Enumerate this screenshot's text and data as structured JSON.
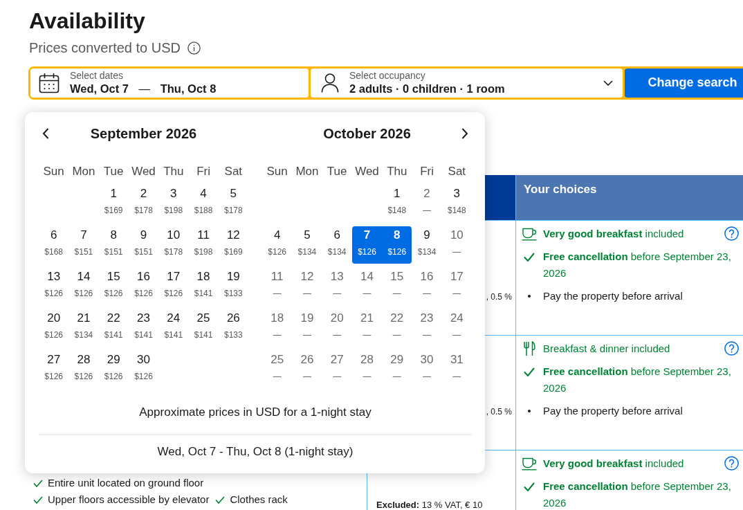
{
  "header": {
    "title": "Availability",
    "subtitle": "Prices converted to USD"
  },
  "search": {
    "dates": {
      "label": "Select dates",
      "check_in": "Wed, Oct 7",
      "separator": "—",
      "check_out": "Thu, Oct 8"
    },
    "occupancy": {
      "label": "Select occupancy",
      "value": "2 adults · 0 children · 1 room"
    },
    "button": "Change search"
  },
  "table": {
    "choices_header": "Your choices",
    "rows": [
      {
        "price": {
          "kind": "fragment",
          "text": ", 0.5 %"
        },
        "choices": [
          {
            "kind": "breakfast",
            "text": "**Very good breakfast** included"
          },
          {
            "kind": "cancellation",
            "text": "**Free cancellation** before September 23, 2026"
          },
          {
            "kind": "payment",
            "text": "Pay the property before arrival"
          }
        ]
      },
      {
        "price": {
          "kind": "fragment",
          "text": ", 0.5 %"
        },
        "choices": [
          {
            "kind": "meals",
            "text": "Breakfast & dinner included"
          },
          {
            "kind": "cancellation",
            "text": "**Free cancellation** before September 23, 2026"
          },
          {
            "kind": "payment",
            "text": "Pay the property before arrival"
          }
        ]
      },
      {
        "facilities": [
          "Entire unit located on ground floor",
          "Upper floors accessible by elevator",
          "Clothes rack"
        ],
        "price": {
          "kind": "excluded",
          "text": "**Excluded:** 13 % VAT, € 10"
        },
        "choices": [
          {
            "kind": "breakfast",
            "text": "**Very good breakfast** included"
          },
          {
            "kind": "cancellation",
            "text": "**Free cancellation** before September 23, 2026"
          }
        ]
      }
    ]
  },
  "calendar": {
    "months": [
      {
        "title": "September 2026",
        "weekdays": [
          "Sun",
          "Mon",
          "Tue",
          "Wed",
          "Thu",
          "Fri",
          "Sat"
        ],
        "days": [
          {
            "kind": "empty"
          },
          {
            "kind": "empty"
          },
          {
            "kind": "day",
            "day": "1",
            "price": "$169",
            "disabled": false,
            "selected": false
          },
          {
            "kind": "day",
            "day": "2",
            "price": "$178",
            "disabled": false,
            "selected": false
          },
          {
            "kind": "day",
            "day": "3",
            "price": "$198",
            "disabled": false,
            "selected": false
          },
          {
            "kind": "day",
            "day": "4",
            "price": "$188",
            "disabled": false,
            "selected": false
          },
          {
            "kind": "day",
            "day": "5",
            "price": "$178",
            "disabled": false,
            "selected": false
          },
          {
            "kind": "day",
            "day": "6",
            "price": "$168",
            "disabled": false,
            "selected": false
          },
          {
            "kind": "day",
            "day": "7",
            "price": "$151",
            "disabled": false,
            "selected": false
          },
          {
            "kind": "day",
            "day": "8",
            "price": "$151",
            "disabled": false,
            "selected": false
          },
          {
            "kind": "day",
            "day": "9",
            "price": "$151",
            "disabled": false,
            "selected": false
          },
          {
            "kind": "day",
            "day": "10",
            "price": "$178",
            "disabled": false,
            "selected": false
          },
          {
            "kind": "day",
            "day": "11",
            "price": "$198",
            "disabled": false,
            "selected": false
          },
          {
            "kind": "day",
            "day": "12",
            "price": "$169",
            "disabled": false,
            "selected": false
          },
          {
            "kind": "day",
            "day": "13",
            "price": "$126",
            "disabled": false,
            "selected": false
          },
          {
            "kind": "day",
            "day": "14",
            "price": "$126",
            "disabled": false,
            "selected": false
          },
          {
            "kind": "day",
            "day": "15",
            "price": "$126",
            "disabled": false,
            "selected": false
          },
          {
            "kind": "day",
            "day": "16",
            "price": "$126",
            "disabled": false,
            "selected": false
          },
          {
            "kind": "day",
            "day": "17",
            "price": "$126",
            "disabled": false,
            "selected": false
          },
          {
            "kind": "day",
            "day": "18",
            "price": "$141",
            "disabled": false,
            "selected": false
          },
          {
            "kind": "day",
            "day": "19",
            "price": "$133",
            "disabled": false,
            "selected": false
          },
          {
            "kind": "day",
            "day": "20",
            "price": "$126",
            "disabled": false,
            "selected": false
          },
          {
            "kind": "day",
            "day": "21",
            "price": "$134",
            "disabled": false,
            "selected": false
          },
          {
            "kind": "day",
            "day": "22",
            "price": "$141",
            "disabled": false,
            "selected": false
          },
          {
            "kind": "day",
            "day": "23",
            "price": "$141",
            "disabled": false,
            "selected": false
          },
          {
            "kind": "day",
            "day": "24",
            "price": "$141",
            "disabled": false,
            "selected": false
          },
          {
            "kind": "day",
            "day": "25",
            "price": "$141",
            "disabled": false,
            "selected": false
          },
          {
            "kind": "day",
            "day": "26",
            "price": "$133",
            "disabled": false,
            "selected": false
          },
          {
            "kind": "day",
            "day": "27",
            "price": "$126",
            "disabled": false,
            "selected": false
          },
          {
            "kind": "day",
            "day": "28",
            "price": "$126",
            "disabled": false,
            "selected": false
          },
          {
            "kind": "day",
            "day": "29",
            "price": "$126",
            "disabled": false,
            "selected": false
          },
          {
            "kind": "day",
            "day": "30",
            "price": "$126",
            "disabled": false,
            "selected": false
          }
        ]
      },
      {
        "title": "October 2026",
        "weekdays": [
          "Sun",
          "Mon",
          "Tue",
          "Wed",
          "Thu",
          "Fri",
          "Sat"
        ],
        "days": [
          {
            "kind": "empty"
          },
          {
            "kind": "empty"
          },
          {
            "kind": "empty"
          },
          {
            "kind": "empty"
          },
          {
            "kind": "day",
            "day": "1",
            "price": "$148",
            "disabled": false,
            "selected": false
          },
          {
            "kind": "day",
            "day": "2",
            "price": "—",
            "disabled": true,
            "selected": false
          },
          {
            "kind": "day",
            "day": "3",
            "price": "$148",
            "disabled": false,
            "selected": false
          },
          {
            "kind": "day",
            "day": "4",
            "price": "$126",
            "disabled": false,
            "selected": false
          },
          {
            "kind": "day",
            "day": "5",
            "price": "$134",
            "disabled": false,
            "selected": false
          },
          {
            "kind": "day",
            "day": "6",
            "price": "$134",
            "disabled": false,
            "selected": false
          },
          {
            "kind": "day",
            "day": "7",
            "price": "$126",
            "disabled": false,
            "selected": true
          },
          {
            "kind": "day",
            "day": "8",
            "price": "$126",
            "disabled": false,
            "selected": true
          },
          {
            "kind": "day",
            "day": "9",
            "price": "$134",
            "disabled": false,
            "selected": false
          },
          {
            "kind": "day",
            "day": "10",
            "price": "—",
            "disabled": true,
            "selected": false
          },
          {
            "kind": "day",
            "day": "11",
            "price": "—",
            "disabled": true,
            "selected": false
          },
          {
            "kind": "day",
            "day": "12",
            "price": "—",
            "disabled": true,
            "selected": false
          },
          {
            "kind": "day",
            "day": "13",
            "price": "—",
            "disabled": true,
            "selected": false
          },
          {
            "kind": "day",
            "day": "14",
            "price": "—",
            "disabled": true,
            "selected": false
          },
          {
            "kind": "day",
            "day": "15",
            "price": "—",
            "disabled": true,
            "selected": false
          },
          {
            "kind": "day",
            "day": "16",
            "price": "—",
            "disabled": true,
            "selected": false
          },
          {
            "kind": "day",
            "day": "17",
            "price": "—",
            "disabled": true,
            "selected": false
          },
          {
            "kind": "day",
            "day": "18",
            "price": "—",
            "disabled": true,
            "selected": false
          },
          {
            "kind": "day",
            "day": "19",
            "price": "—",
            "disabled": true,
            "selected": false
          },
          {
            "kind": "day",
            "day": "20",
            "price": "—",
            "disabled": true,
            "selected": false
          },
          {
            "kind": "day",
            "day": "21",
            "price": "—",
            "disabled": true,
            "selected": false
          },
          {
            "kind": "day",
            "day": "22",
            "price": "—",
            "disabled": true,
            "selected": false
          },
          {
            "kind": "day",
            "day": "23",
            "price": "—",
            "disabled": true,
            "selected": false
          },
          {
            "kind": "day",
            "day": "24",
            "price": "—",
            "disabled": true,
            "selected": false
          },
          {
            "kind": "day",
            "day": "25",
            "price": "—",
            "disabled": true,
            "selected": false
          },
          {
            "kind": "day",
            "day": "26",
            "price": "—",
            "disabled": true,
            "selected": false
          },
          {
            "kind": "day",
            "day": "27",
            "price": "—",
            "disabled": true,
            "selected": false
          },
          {
            "kind": "day",
            "day": "28",
            "price": "—",
            "disabled": true,
            "selected": false
          },
          {
            "kind": "day",
            "day": "29",
            "price": "—",
            "disabled": true,
            "selected": false
          },
          {
            "kind": "day",
            "day": "30",
            "price": "—",
            "disabled": true,
            "selected": false
          },
          {
            "kind": "day",
            "day": "31",
            "price": "—",
            "disabled": true,
            "selected": false
          }
        ]
      }
    ],
    "note": "Approximate prices in USD for a 1-night stay",
    "summary": "Wed, Oct 7 - Thu, Oct 8 (1-night stay)"
  }
}
